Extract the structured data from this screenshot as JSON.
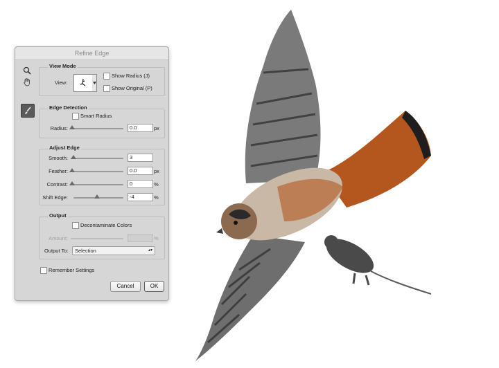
{
  "dialog": {
    "title": "Refine Edge",
    "view_mode": {
      "title": "View Mode",
      "view_label": "View:",
      "show_radius": "Show Radius (J)",
      "show_original": "Show Original (P)"
    },
    "edge_detection": {
      "title": "Edge Detection",
      "smart_radius": "Smart Radius",
      "radius_label": "Radius:",
      "radius_value": "0.0",
      "radius_unit": "px"
    },
    "adjust_edge": {
      "title": "Adjust Edge",
      "smooth_label": "Smooth:",
      "smooth_value": "3",
      "feather_label": "Feather:",
      "feather_value": "0.0",
      "feather_unit": "px",
      "contrast_label": "Contrast:",
      "contrast_value": "0",
      "contrast_unit": "%",
      "shift_label": "Shift Edge:",
      "shift_value": "-4",
      "shift_unit": "%"
    },
    "output": {
      "title": "Output",
      "decontaminate": "Decontaminate Colors",
      "amount_label": "Amount:",
      "amount_unit": "%",
      "output_to_label": "Output To:",
      "output_to_value": "Selection"
    },
    "remember": "Remember Settings",
    "cancel": "Cancel",
    "ok": "OK"
  },
  "colors": {
    "dialog_bg": "#d6d6d6",
    "bird_rufous": "#b4571f",
    "bird_gray": "#6b6b6b"
  }
}
